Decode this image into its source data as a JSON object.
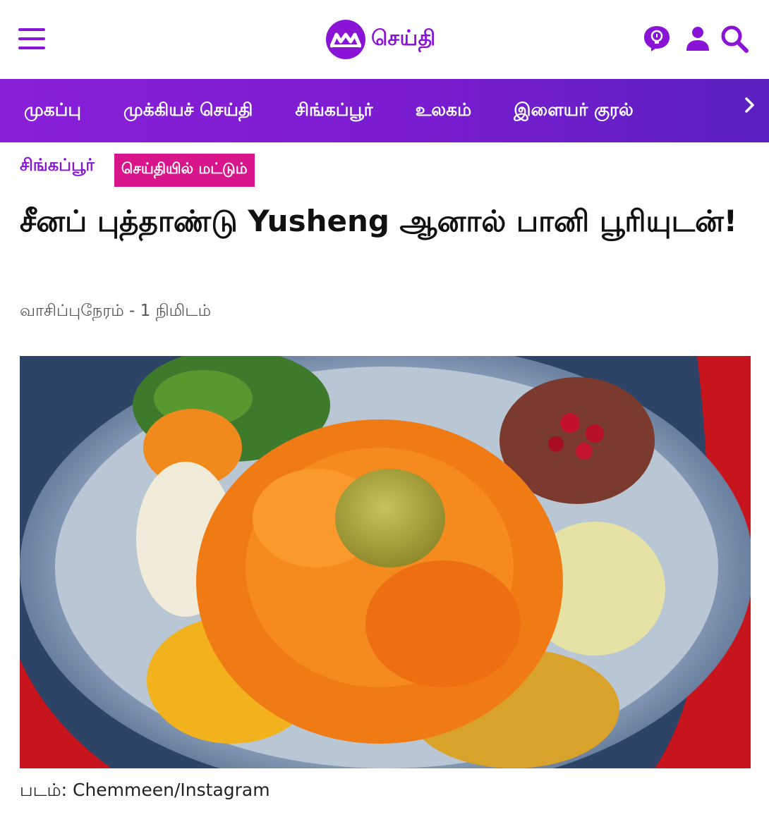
{
  "header": {
    "logo_text": "செய்தி",
    "icons": [
      "menu-icon",
      "lightbulb-icon",
      "user-icon",
      "search-icon"
    ],
    "brand_color": "#8a14d6"
  },
  "nav": {
    "items": [
      "முகப்பு",
      "முக்கியச் செய்தி",
      "சிங்கப்பூர்",
      "உலகம்",
      "இளையர் குரல்"
    ],
    "background": "#7a1ccf"
  },
  "article": {
    "section": "சிங்கப்பூர்",
    "badge": "செய்தியில் மட்டும்",
    "badge_color": "#d9158c",
    "title": "சீனப் புத்தாண்டு Yusheng ஆனால் பானி பூரியுடன்!",
    "read_time": "வாசிப்புநேரம் - 1 நிமிடம்",
    "image_caption": "படம்: Chemmeen/Instagram"
  }
}
